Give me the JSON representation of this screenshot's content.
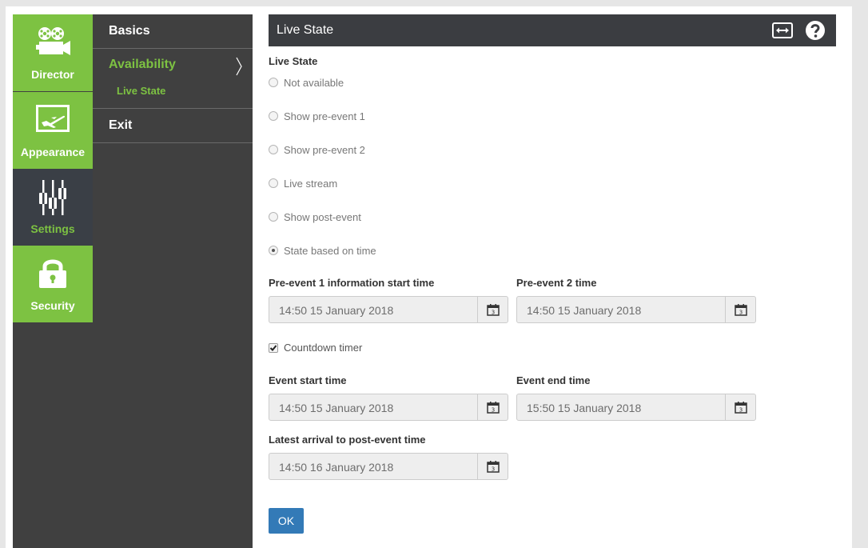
{
  "nav": {
    "items": [
      {
        "label": "Director",
        "icon": "film-camera-icon"
      },
      {
        "label": "Appearance",
        "icon": "airplane-picture-icon"
      },
      {
        "label": "Settings",
        "icon": "sliders-icon"
      },
      {
        "label": "Security",
        "icon": "padlock-icon"
      }
    ],
    "active": "Settings"
  },
  "submenu": {
    "basics": "Basics",
    "availability": "Availability",
    "live_state": "Live State",
    "exit": "Exit"
  },
  "header": {
    "title": "Live State"
  },
  "live_state": {
    "section_title": "Live State",
    "options": [
      {
        "label": "Not available",
        "checked": false
      },
      {
        "label": "Show pre-event 1",
        "checked": false
      },
      {
        "label": "Show pre-event 2",
        "checked": false
      },
      {
        "label": "Live stream",
        "checked": false
      },
      {
        "label": "Show post-event",
        "checked": false
      },
      {
        "label": "State based on time",
        "checked": true
      }
    ]
  },
  "times": {
    "pre_event_1": {
      "label": "Pre-event 1 information start time",
      "value": "14:50  15 January 2018"
    },
    "pre_event_2": {
      "label": "Pre-event 2 time",
      "value": "14:50  15 January 2018"
    },
    "countdown": {
      "label": "Countdown timer",
      "checked": true
    },
    "event_start": {
      "label": "Event start time",
      "value": "14:50  15 January 2018"
    },
    "event_end": {
      "label": "Event end time",
      "value": "15:50  15 January 2018"
    },
    "post_event": {
      "label": "Latest arrival to post-event time",
      "value": "14:50  16 January 2018"
    }
  },
  "calendar_day": "3",
  "ok_label": "OK",
  "colors": {
    "accent_green": "#7dc242",
    "dark_panel": "#404040",
    "header_bg": "#3b3d41",
    "primary_button": "#337ab7"
  }
}
